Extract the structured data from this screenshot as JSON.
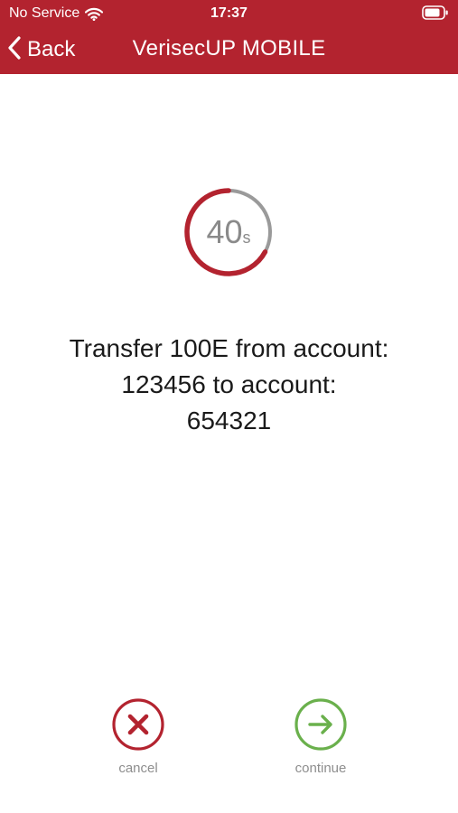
{
  "status_bar": {
    "carrier": "No Service",
    "time": "17:37",
    "wifi_icon": "wifi-icon",
    "battery_icon": "battery-icon"
  },
  "nav": {
    "back_label": "Back",
    "title": "VerisecUP MOBILE"
  },
  "countdown": {
    "value": "40",
    "unit": "s",
    "remaining_fraction": 0.67
  },
  "message": {
    "lines": [
      "Transfer 100E from account:",
      "123456 to account:",
      "654321"
    ]
  },
  "actions": {
    "cancel_label": "cancel",
    "continue_label": "continue"
  },
  "colors": {
    "brand": "#b3232f",
    "cancel": "#b3232f",
    "continue": "#6ab04c",
    "ring_track": "#9a9a9a"
  }
}
